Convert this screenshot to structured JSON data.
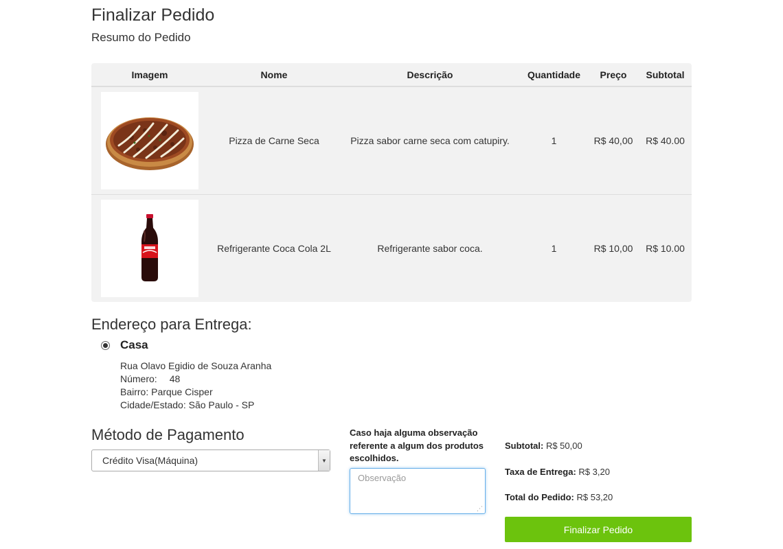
{
  "page": {
    "title": "Finalizar Pedido",
    "subtitle": "Resumo do Pedido"
  },
  "table": {
    "headers": [
      "Imagem",
      "Nome",
      "Descrição",
      "Quantidade",
      "Preço",
      "Subtotal"
    ],
    "rows": [
      {
        "image": "pizza-image",
        "name": "Pizza de Carne Seca",
        "description": "Pizza sabor carne seca com catupiry.",
        "quantity": "1",
        "price": "R$ 40,00",
        "subtotal": "R$ 40.00"
      },
      {
        "image": "coca-cola-bottle-image",
        "name": "Refrigerante Coca Cola 2L",
        "description": "Refrigerante sabor coca.",
        "quantity": "1",
        "price": "R$ 10,00",
        "subtotal": "R$ 10.00"
      }
    ]
  },
  "address": {
    "title": "Endereço para Entrega:",
    "name": "Casa",
    "street": "Rua Olavo Egidio de Souza Aranha",
    "number_label": "Número:",
    "number_value": "48",
    "neighborhood": "Bairro: Parque Cisper",
    "city_state": "Cidade/Estado: São Paulo - SP",
    "selected": true
  },
  "payment": {
    "title": "Método de Pagamento",
    "selected": "Crédito Visa(Máquina)"
  },
  "observation": {
    "label": "Caso haja alguma observação referente a algum dos produtos escolhidos.",
    "placeholder": "Observação",
    "value": ""
  },
  "summary": {
    "subtotal_label": "Subtotal:",
    "subtotal_value": "R$ 50,00",
    "tax_label": "Taxa de Entrega:",
    "tax_value": "R$ 3,20",
    "total_label": "Total do Pedido:",
    "total_value": "R$ 53,20"
  },
  "actions": {
    "finish_label": "Finalizar Pedido"
  },
  "colors": {
    "button_green": "#6cc30d",
    "table_background": "#f2f2f2",
    "focus_blue": "#66afe9"
  }
}
